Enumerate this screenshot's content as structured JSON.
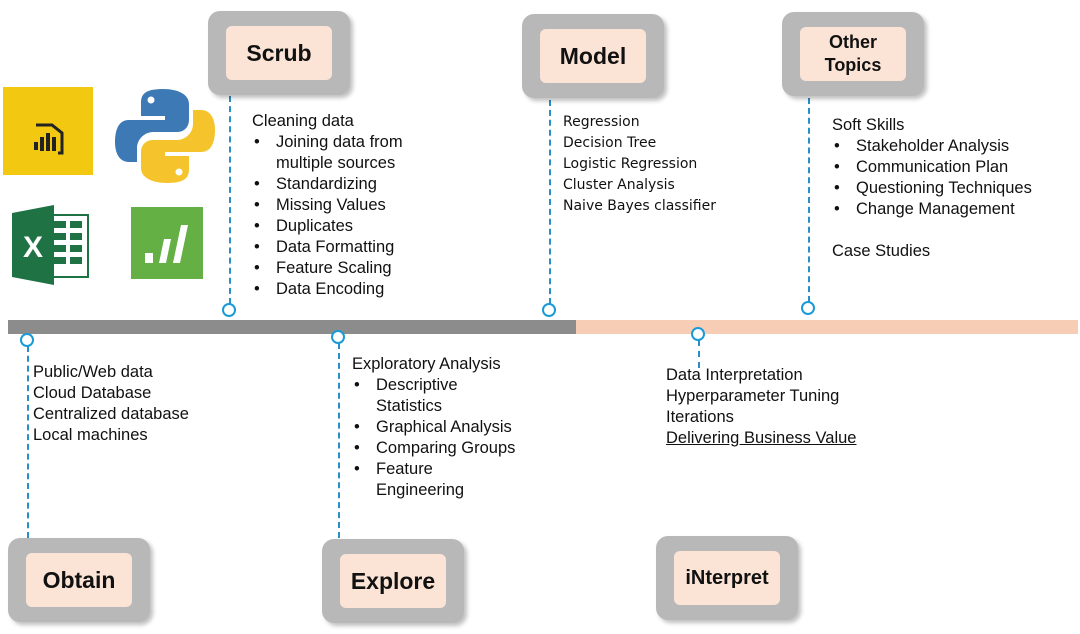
{
  "stages": {
    "scrub": {
      "title": "Scrub",
      "heading": "Cleaning data",
      "items": [
        "Joining data from multiple sources",
        "Standardizing",
        "Missing Values",
        "Duplicates",
        "Data Formatting",
        "Feature Scaling",
        "Data Encoding"
      ]
    },
    "model": {
      "title": "Model",
      "items": [
        "Regression",
        "Decision Tree",
        "Logistic Regression",
        "Cluster Analysis",
        "Naive Bayes classifier"
      ]
    },
    "other": {
      "title": "Other Topics",
      "heading": "Soft Skills",
      "items": [
        "Stakeholder Analysis",
        "Communication Plan",
        "Questioning Techniques",
        "Change Management"
      ],
      "footer": "Case Studies"
    },
    "obtain": {
      "title": "Obtain",
      "items": [
        "Public/Web data",
        "Cloud Database",
        "Centralized database",
        "Local machines"
      ]
    },
    "explore": {
      "title": "Explore",
      "heading": "Exploratory Analysis",
      "items": [
        "Descriptive Statistics",
        "Graphical Analysis",
        "Comparing Groups",
        "Feature Engineering"
      ]
    },
    "interpret": {
      "title": "iNterpret",
      "items": [
        "Data Interpretation",
        "Hyperparameter Tuning",
        "Iterations",
        "Delivering Business Value"
      ]
    }
  },
  "logos": [
    "power-bi-icon",
    "python-icon",
    "excel-icon",
    "minitab-icon"
  ],
  "colors": {
    "timeline_done": "#8c8c8c",
    "timeline_todo": "#f7cdb5",
    "box_outer": "#b8b8b8",
    "box_inner": "#fbe4d6",
    "marker": "#1a9ad6"
  }
}
